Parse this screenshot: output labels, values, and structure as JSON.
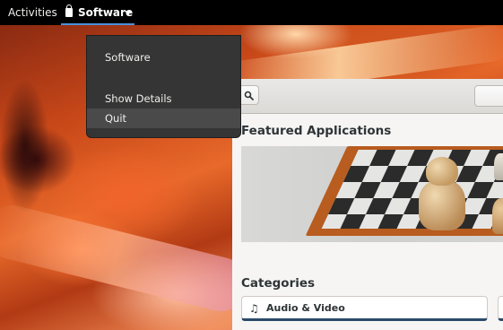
{
  "topbar": {
    "activities_label": "Activities",
    "app_menu": {
      "label": "Software",
      "icon": "shopping-bag-icon"
    }
  },
  "app_menu_popover": {
    "items": [
      {
        "label": "Software"
      },
      {
        "label": "Show Details"
      },
      {
        "label": "Quit",
        "highlighted": true
      }
    ]
  },
  "window": {
    "header": {
      "search_icon": "search-icon"
    },
    "featured": {
      "title": "Featured Applications"
    },
    "categories": {
      "title": "Categories",
      "items": [
        {
          "label": "Audio & Video",
          "icon": "music-note-icon"
        }
      ]
    }
  },
  "colors": {
    "topbar_bg": "#000000",
    "menu_bg": "#353535",
    "accent": "#4a90d9",
    "category_border": "#2b4a6a"
  }
}
